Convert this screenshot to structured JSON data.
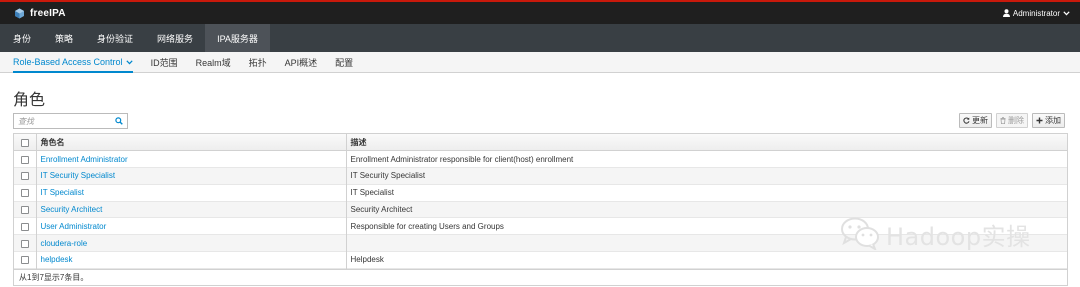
{
  "brand": {
    "name": "freeIPA"
  },
  "user_menu": {
    "label": "Administrator"
  },
  "main_nav": [
    {
      "label": "身份",
      "active": false
    },
    {
      "label": "策略",
      "active": false
    },
    {
      "label": "身份验证",
      "active": false
    },
    {
      "label": "网络服务",
      "active": false
    },
    {
      "label": "IPA服务器",
      "active": true
    }
  ],
  "sub_nav": [
    {
      "label": "Role-Based Access Control",
      "active": true
    },
    {
      "label": "ID范围",
      "active": false
    },
    {
      "label": "Realm域",
      "active": false
    },
    {
      "label": "拓扑",
      "active": false
    },
    {
      "label": "API概述",
      "active": false
    },
    {
      "label": "配置",
      "active": false
    }
  ],
  "page_title": "角色",
  "search": {
    "placeholder": "查找",
    "value": ""
  },
  "toolbar": {
    "refresh_label": "更新",
    "delete_label": "删除",
    "add_label": "添加"
  },
  "table": {
    "columns": [
      "角色名",
      "描述"
    ],
    "rows": [
      {
        "name": "Enrollment Administrator",
        "description": "Enrollment Administrator responsible for client(host) enrollment"
      },
      {
        "name": "IT Security Specialist",
        "description": "IT Security Specialist"
      },
      {
        "name": "IT Specialist",
        "description": "IT Specialist"
      },
      {
        "name": "Security Architect",
        "description": "Security Architect"
      },
      {
        "name": "User Administrator",
        "description": "Responsible for creating Users and Groups"
      },
      {
        "name": "cloudera-role",
        "description": ""
      },
      {
        "name": "helpdesk",
        "description": "Helpdesk"
      }
    ],
    "footer": "从1到7显示7条目。"
  },
  "watermark": {
    "text": "Hadoop实操"
  },
  "colors": {
    "top_bar": "#1f1f1f",
    "accent_red": "#c9190b",
    "main_nav": "#393f44",
    "main_nav_active": "#4d5258",
    "link_blue": "#0088ce"
  }
}
